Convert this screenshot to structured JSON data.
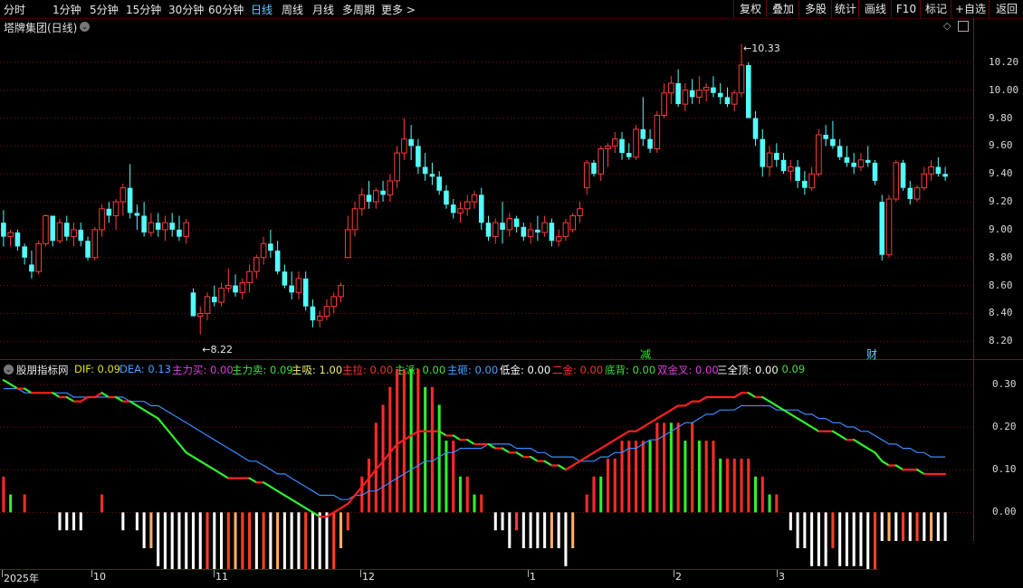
{
  "toolbar": {
    "periods": [
      "分时",
      "1分钟",
      "5分钟",
      "15分钟",
      "30分钟",
      "60分钟",
      "日线",
      "周线",
      "月线",
      "多周期",
      "更多 >"
    ],
    "active_period": "日线",
    "buttons": [
      "复权",
      "叠加",
      "多股",
      "统计",
      "画线",
      "F10",
      "标记",
      "+自选",
      "返回"
    ]
  },
  "main": {
    "title": "塔牌集团(日线)",
    "price_high_label": "10.33",
    "price_low_label": "8.22",
    "y_ticks": [
      "10.20",
      "10.00",
      "9.80",
      "9.60",
      "9.40",
      "9.20",
      "9.00",
      "8.80",
      "8.60",
      "8.40",
      "8.20"
    ],
    "markers": [
      {
        "text": "减",
        "color": "#2de82d"
      },
      {
        "text": "财",
        "color": "#5fd0ff"
      }
    ]
  },
  "indicator": {
    "name": "股朋指标网",
    "legend": [
      {
        "label": "DIF: 0.09",
        "color": "#e0e020"
      },
      {
        "label": "DEA: 0.13",
        "color": "#4aa0ff"
      },
      {
        "label": "主力买: 0.00",
        "color": "#e040e0"
      },
      {
        "label": "主力卖: 0.09",
        "color": "#40e040"
      },
      {
        "label": "主吸: 1.00",
        "color": "#f0f070"
      },
      {
        "label": "主拉: 0.00",
        "color": "#ff3030"
      },
      {
        "label": "主派: 0.00",
        "color": "#40e040"
      },
      {
        "label": "主砸: 0.00",
        "color": "#4aa0ff"
      },
      {
        "label": "低金: 0.00",
        "color": "#ffffff"
      },
      {
        "label": "二金: 0.00",
        "color": "#ff3030"
      },
      {
        "label": "底背: 0.00",
        "color": "#40e040"
      },
      {
        "label": "双金叉: 0.00",
        "color": "#e040e0"
      },
      {
        "label": "三全顶: 0.00",
        "color": "#ffffff"
      },
      {
        "label": ": 0.09",
        "color": "#40e040"
      }
    ],
    "y_ticks": [
      "0.30",
      "0.20",
      "0.10",
      "0.00"
    ]
  },
  "dates": [
    "2025年",
    "10",
    "11",
    "12",
    "1",
    "2",
    "3"
  ],
  "colors": {
    "up": "#ff3b3b",
    "down": "#54fcfc",
    "grid": "#8a1010",
    "dif_up": "#ff2020",
    "dif_down": "#30f030",
    "dea": "#3c8cff"
  },
  "chart_data": {
    "type": "candlestick",
    "price_range": [
      8.15,
      10.4
    ],
    "indicator_range": [
      -0.12,
      0.34
    ],
    "candles": [
      [
        9.05,
        9.14,
        8.88,
        8.95
      ],
      [
        8.95,
        9.0,
        8.88,
        8.98
      ],
      [
        8.98,
        9.0,
        8.85,
        8.88
      ],
      [
        8.88,
        8.9,
        8.75,
        8.8
      ],
      [
        8.75,
        8.85,
        8.65,
        8.7
      ],
      [
        8.7,
        8.92,
        8.68,
        8.9
      ],
      [
        8.9,
        9.11,
        8.88,
        9.1
      ],
      [
        9.1,
        9.1,
        8.88,
        8.92
      ],
      [
        8.92,
        9.08,
        8.9,
        9.05
      ],
      [
        9.05,
        9.1,
        8.92,
        8.95
      ],
      [
        8.95,
        9.05,
        8.88,
        9.0
      ],
      [
        9.0,
        9.05,
        8.88,
        8.92
      ],
      [
        8.92,
        8.95,
        8.78,
        8.8
      ],
      [
        8.8,
        9.02,
        8.78,
        9.0
      ],
      [
        9.0,
        9.18,
        8.95,
        9.15
      ],
      [
        9.15,
        9.2,
        9.05,
        9.1
      ],
      [
        9.1,
        9.22,
        9.0,
        9.2
      ],
      [
        9.2,
        9.33,
        9.1,
        9.3
      ],
      [
        9.3,
        9.47,
        9.08,
        9.12
      ],
      [
        9.12,
        9.18,
        9.0,
        9.1
      ],
      [
        9.1,
        9.2,
        8.95,
        8.98
      ],
      [
        8.98,
        9.12,
        8.95,
        9.05
      ],
      [
        9.05,
        9.12,
        8.95,
        9.0
      ],
      [
        9.0,
        9.1,
        8.92,
        9.05
      ],
      [
        9.05,
        9.12,
        8.95,
        9.0
      ],
      [
        9.0,
        9.1,
        8.92,
        8.95
      ],
      [
        8.95,
        9.08,
        8.9,
        9.05
      ],
      [
        8.55,
        8.58,
        8.38,
        8.38
      ],
      [
        8.38,
        8.45,
        8.25,
        8.4
      ],
      [
        8.4,
        8.55,
        8.35,
        8.52
      ],
      [
        8.52,
        8.6,
        8.45,
        8.48
      ],
      [
        8.48,
        8.62,
        8.45,
        8.58
      ],
      [
        8.58,
        8.72,
        8.55,
        8.6
      ],
      [
        8.6,
        8.68,
        8.52,
        8.55
      ],
      [
        8.55,
        8.65,
        8.5,
        8.62
      ],
      [
        8.62,
        8.75,
        8.55,
        8.7
      ],
      [
        8.7,
        8.82,
        8.65,
        8.8
      ],
      [
        8.8,
        8.95,
        8.75,
        8.9
      ],
      [
        8.9,
        9.0,
        8.8,
        8.85
      ],
      [
        8.85,
        8.92,
        8.68,
        8.7
      ],
      [
        8.7,
        8.75,
        8.58,
        8.6
      ],
      [
        8.6,
        8.7,
        8.5,
        8.55
      ],
      [
        8.55,
        8.7,
        8.5,
        8.65
      ],
      [
        8.65,
        8.7,
        8.42,
        8.45
      ],
      [
        8.45,
        8.5,
        8.3,
        8.35
      ],
      [
        8.35,
        8.42,
        8.3,
        8.38
      ],
      [
        8.38,
        8.5,
        8.35,
        8.45
      ],
      [
        8.45,
        8.55,
        8.4,
        8.52
      ],
      [
        8.52,
        8.62,
        8.48,
        8.6
      ],
      [
        8.8,
        9.1,
        8.8,
        9.0
      ],
      [
        9.0,
        9.2,
        8.95,
        9.15
      ],
      [
        9.15,
        9.3,
        9.1,
        9.25
      ],
      [
        9.25,
        9.35,
        9.15,
        9.2
      ],
      [
        9.2,
        9.3,
        9.15,
        9.28
      ],
      [
        9.28,
        9.35,
        9.2,
        9.25
      ],
      [
        9.25,
        9.4,
        9.2,
        9.35
      ],
      [
        9.35,
        9.6,
        9.3,
        9.55
      ],
      [
        9.55,
        9.8,
        9.5,
        9.65
      ],
      [
        9.65,
        9.75,
        9.5,
        9.6
      ],
      [
        9.6,
        9.65,
        9.4,
        9.45
      ],
      [
        9.45,
        9.55,
        9.35,
        9.4
      ],
      [
        9.4,
        9.48,
        9.32,
        9.38
      ],
      [
        9.38,
        9.42,
        9.25,
        9.28
      ],
      [
        9.28,
        9.32,
        9.15,
        9.18
      ],
      [
        9.18,
        9.22,
        9.08,
        9.12
      ],
      [
        9.12,
        9.2,
        9.05,
        9.15
      ],
      [
        9.15,
        9.25,
        9.1,
        9.2
      ],
      [
        9.2,
        9.28,
        9.15,
        9.25
      ],
      [
        9.25,
        9.3,
        9.0,
        9.05
      ],
      [
        9.05,
        9.1,
        8.92,
        8.95
      ],
      [
        8.95,
        9.08,
        8.9,
        9.05
      ],
      [
        9.05,
        9.2,
        8.9,
        9.0
      ],
      [
        9.0,
        9.12,
        8.95,
        9.08
      ],
      [
        9.08,
        9.1,
        8.98,
        9.02
      ],
      [
        9.02,
        9.05,
        8.92,
        8.95
      ],
      [
        8.95,
        9.05,
        8.9,
        9.0
      ],
      [
        9.0,
        9.1,
        8.92,
        8.98
      ],
      [
        8.98,
        9.1,
        8.95,
        9.05
      ],
      [
        9.05,
        9.08,
        8.88,
        8.92
      ],
      [
        8.92,
        9.0,
        8.88,
        8.95
      ],
      [
        8.95,
        9.08,
        8.92,
        9.05
      ],
      [
        9.0,
        9.12,
        8.98,
        9.1
      ],
      [
        9.1,
        9.2,
        9.05,
        9.15
      ],
      [
        9.3,
        9.5,
        9.25,
        9.48
      ],
      [
        9.48,
        9.5,
        9.38,
        9.4
      ],
      [
        9.4,
        9.6,
        9.35,
        9.58
      ],
      [
        9.58,
        9.62,
        9.45,
        9.6
      ],
      [
        9.6,
        9.7,
        9.55,
        9.65
      ],
      [
        9.65,
        9.7,
        9.5,
        9.55
      ],
      [
        9.55,
        9.62,
        9.5,
        9.52
      ],
      [
        9.52,
        9.75,
        9.5,
        9.72
      ],
      [
        9.72,
        9.95,
        9.6,
        9.65
      ],
      [
        9.65,
        9.72,
        9.55,
        9.58
      ],
      [
        9.58,
        9.85,
        9.55,
        9.82
      ],
      [
        9.82,
        10.05,
        9.8,
        9.98
      ],
      [
        9.98,
        10.1,
        9.9,
        10.05
      ],
      [
        10.05,
        10.15,
        9.88,
        9.9
      ],
      [
        9.9,
        10.05,
        9.85,
        10.0
      ],
      [
        10.0,
        10.08,
        9.9,
        9.95
      ],
      [
        9.95,
        10.1,
        9.9,
        10.0
      ],
      [
        10.0,
        10.05,
        9.92,
        10.02
      ],
      [
        10.02,
        10.1,
        9.95,
        9.98
      ],
      [
        9.98,
        10.05,
        9.9,
        9.95
      ],
      [
        9.95,
        10.02,
        9.88,
        9.9
      ],
      [
        9.9,
        10.0,
        9.85,
        9.98
      ],
      [
        9.98,
        10.33,
        9.95,
        10.18
      ],
      [
        10.18,
        10.2,
        9.8,
        9.8
      ],
      [
        9.8,
        9.85,
        9.6,
        9.65
      ],
      [
        9.65,
        9.72,
        9.38,
        9.45
      ],
      [
        9.45,
        9.6,
        9.38,
        9.55
      ],
      [
        9.55,
        9.62,
        9.45,
        9.5
      ],
      [
        9.5,
        9.55,
        9.4,
        9.42
      ],
      [
        9.42,
        9.5,
        9.35,
        9.45
      ],
      [
        9.45,
        9.5,
        9.3,
        9.35
      ],
      [
        9.35,
        9.42,
        9.25,
        9.3
      ],
      [
        9.3,
        9.45,
        9.28,
        9.4
      ],
      [
        9.4,
        9.72,
        9.38,
        9.68
      ],
      [
        9.68,
        9.75,
        9.6,
        9.65
      ],
      [
        9.65,
        9.78,
        9.58,
        9.6
      ],
      [
        9.6,
        9.65,
        9.5,
        9.52
      ],
      [
        9.52,
        9.6,
        9.45,
        9.48
      ],
      [
        9.48,
        9.55,
        9.4,
        9.45
      ],
      [
        9.45,
        9.55,
        9.42,
        9.5
      ],
      [
        9.5,
        9.6,
        9.45,
        9.48
      ],
      [
        9.48,
        9.5,
        9.32,
        9.35
      ],
      [
        9.2,
        9.25,
        8.78,
        8.82
      ],
      [
        8.82,
        9.25,
        8.8,
        9.22
      ],
      [
        9.22,
        9.5,
        9.2,
        9.48
      ],
      [
        9.48,
        9.5,
        9.28,
        9.3
      ],
      [
        9.3,
        9.35,
        9.18,
        9.22
      ],
      [
        9.22,
        9.32,
        9.2,
        9.3
      ],
      [
        9.3,
        9.45,
        9.28,
        9.4
      ],
      [
        9.4,
        9.5,
        9.35,
        9.45
      ],
      [
        9.45,
        9.52,
        9.38,
        9.4
      ],
      [
        9.4,
        9.45,
        9.35,
        9.38
      ]
    ],
    "dif": [
      0.31,
      0.3,
      0.29,
      0.29,
      0.28,
      0.28,
      0.28,
      0.28,
      0.27,
      0.27,
      0.26,
      0.26,
      0.27,
      0.27,
      0.28,
      0.27,
      0.27,
      0.26,
      0.26,
      0.25,
      0.24,
      0.23,
      0.22,
      0.2,
      0.18,
      0.16,
      0.14,
      0.13,
      0.12,
      0.11,
      0.1,
      0.09,
      0.08,
      0.08,
      0.08,
      0.08,
      0.07,
      0.07,
      0.06,
      0.05,
      0.04,
      0.03,
      0.02,
      0.01,
      0.0,
      -0.01,
      -0.01,
      0.0,
      0.01,
      0.02,
      0.04,
      0.06,
      0.08,
      0.1,
      0.12,
      0.14,
      0.16,
      0.17,
      0.18,
      0.19,
      0.19,
      0.19,
      0.19,
      0.18,
      0.18,
      0.17,
      0.17,
      0.16,
      0.16,
      0.16,
      0.15,
      0.15,
      0.14,
      0.14,
      0.13,
      0.13,
      0.12,
      0.12,
      0.11,
      0.11,
      0.1,
      0.11,
      0.12,
      0.13,
      0.14,
      0.15,
      0.16,
      0.17,
      0.18,
      0.19,
      0.19,
      0.2,
      0.21,
      0.22,
      0.23,
      0.24,
      0.25,
      0.25,
      0.26,
      0.26,
      0.27,
      0.27,
      0.27,
      0.27,
      0.27,
      0.28,
      0.28,
      0.27,
      0.27,
      0.26,
      0.25,
      0.24,
      0.23,
      0.22,
      0.21,
      0.2,
      0.19,
      0.19,
      0.19,
      0.18,
      0.17,
      0.17,
      0.16,
      0.15,
      0.14,
      0.12,
      0.11,
      0.11,
      0.1,
      0.1,
      0.1,
      0.09,
      0.09,
      0.09,
      0.09
    ],
    "dea": [
      0.29,
      0.29,
      0.29,
      0.28,
      0.28,
      0.28,
      0.28,
      0.28,
      0.28,
      0.28,
      0.27,
      0.27,
      0.27,
      0.27,
      0.27,
      0.27,
      0.27,
      0.27,
      0.26,
      0.26,
      0.26,
      0.25,
      0.25,
      0.24,
      0.23,
      0.22,
      0.21,
      0.2,
      0.19,
      0.18,
      0.17,
      0.16,
      0.15,
      0.14,
      0.13,
      0.12,
      0.12,
      0.11,
      0.1,
      0.09,
      0.09,
      0.08,
      0.07,
      0.06,
      0.05,
      0.04,
      0.04,
      0.04,
      0.03,
      0.03,
      0.04,
      0.04,
      0.05,
      0.05,
      0.06,
      0.07,
      0.08,
      0.09,
      0.1,
      0.11,
      0.12,
      0.12,
      0.13,
      0.14,
      0.14,
      0.15,
      0.15,
      0.15,
      0.15,
      0.16,
      0.16,
      0.16,
      0.16,
      0.15,
      0.15,
      0.15,
      0.14,
      0.14,
      0.13,
      0.13,
      0.13,
      0.13,
      0.12,
      0.12,
      0.12,
      0.13,
      0.13,
      0.14,
      0.14,
      0.15,
      0.15,
      0.16,
      0.17,
      0.17,
      0.18,
      0.19,
      0.2,
      0.21,
      0.21,
      0.22,
      0.23,
      0.23,
      0.24,
      0.24,
      0.24,
      0.25,
      0.25,
      0.25,
      0.25,
      0.25,
      0.24,
      0.24,
      0.24,
      0.24,
      0.23,
      0.23,
      0.22,
      0.22,
      0.21,
      0.21,
      0.2,
      0.2,
      0.19,
      0.19,
      0.18,
      0.17,
      0.16,
      0.16,
      0.15,
      0.15,
      0.14,
      0.14,
      0.13,
      0.13,
      0.13
    ]
  }
}
